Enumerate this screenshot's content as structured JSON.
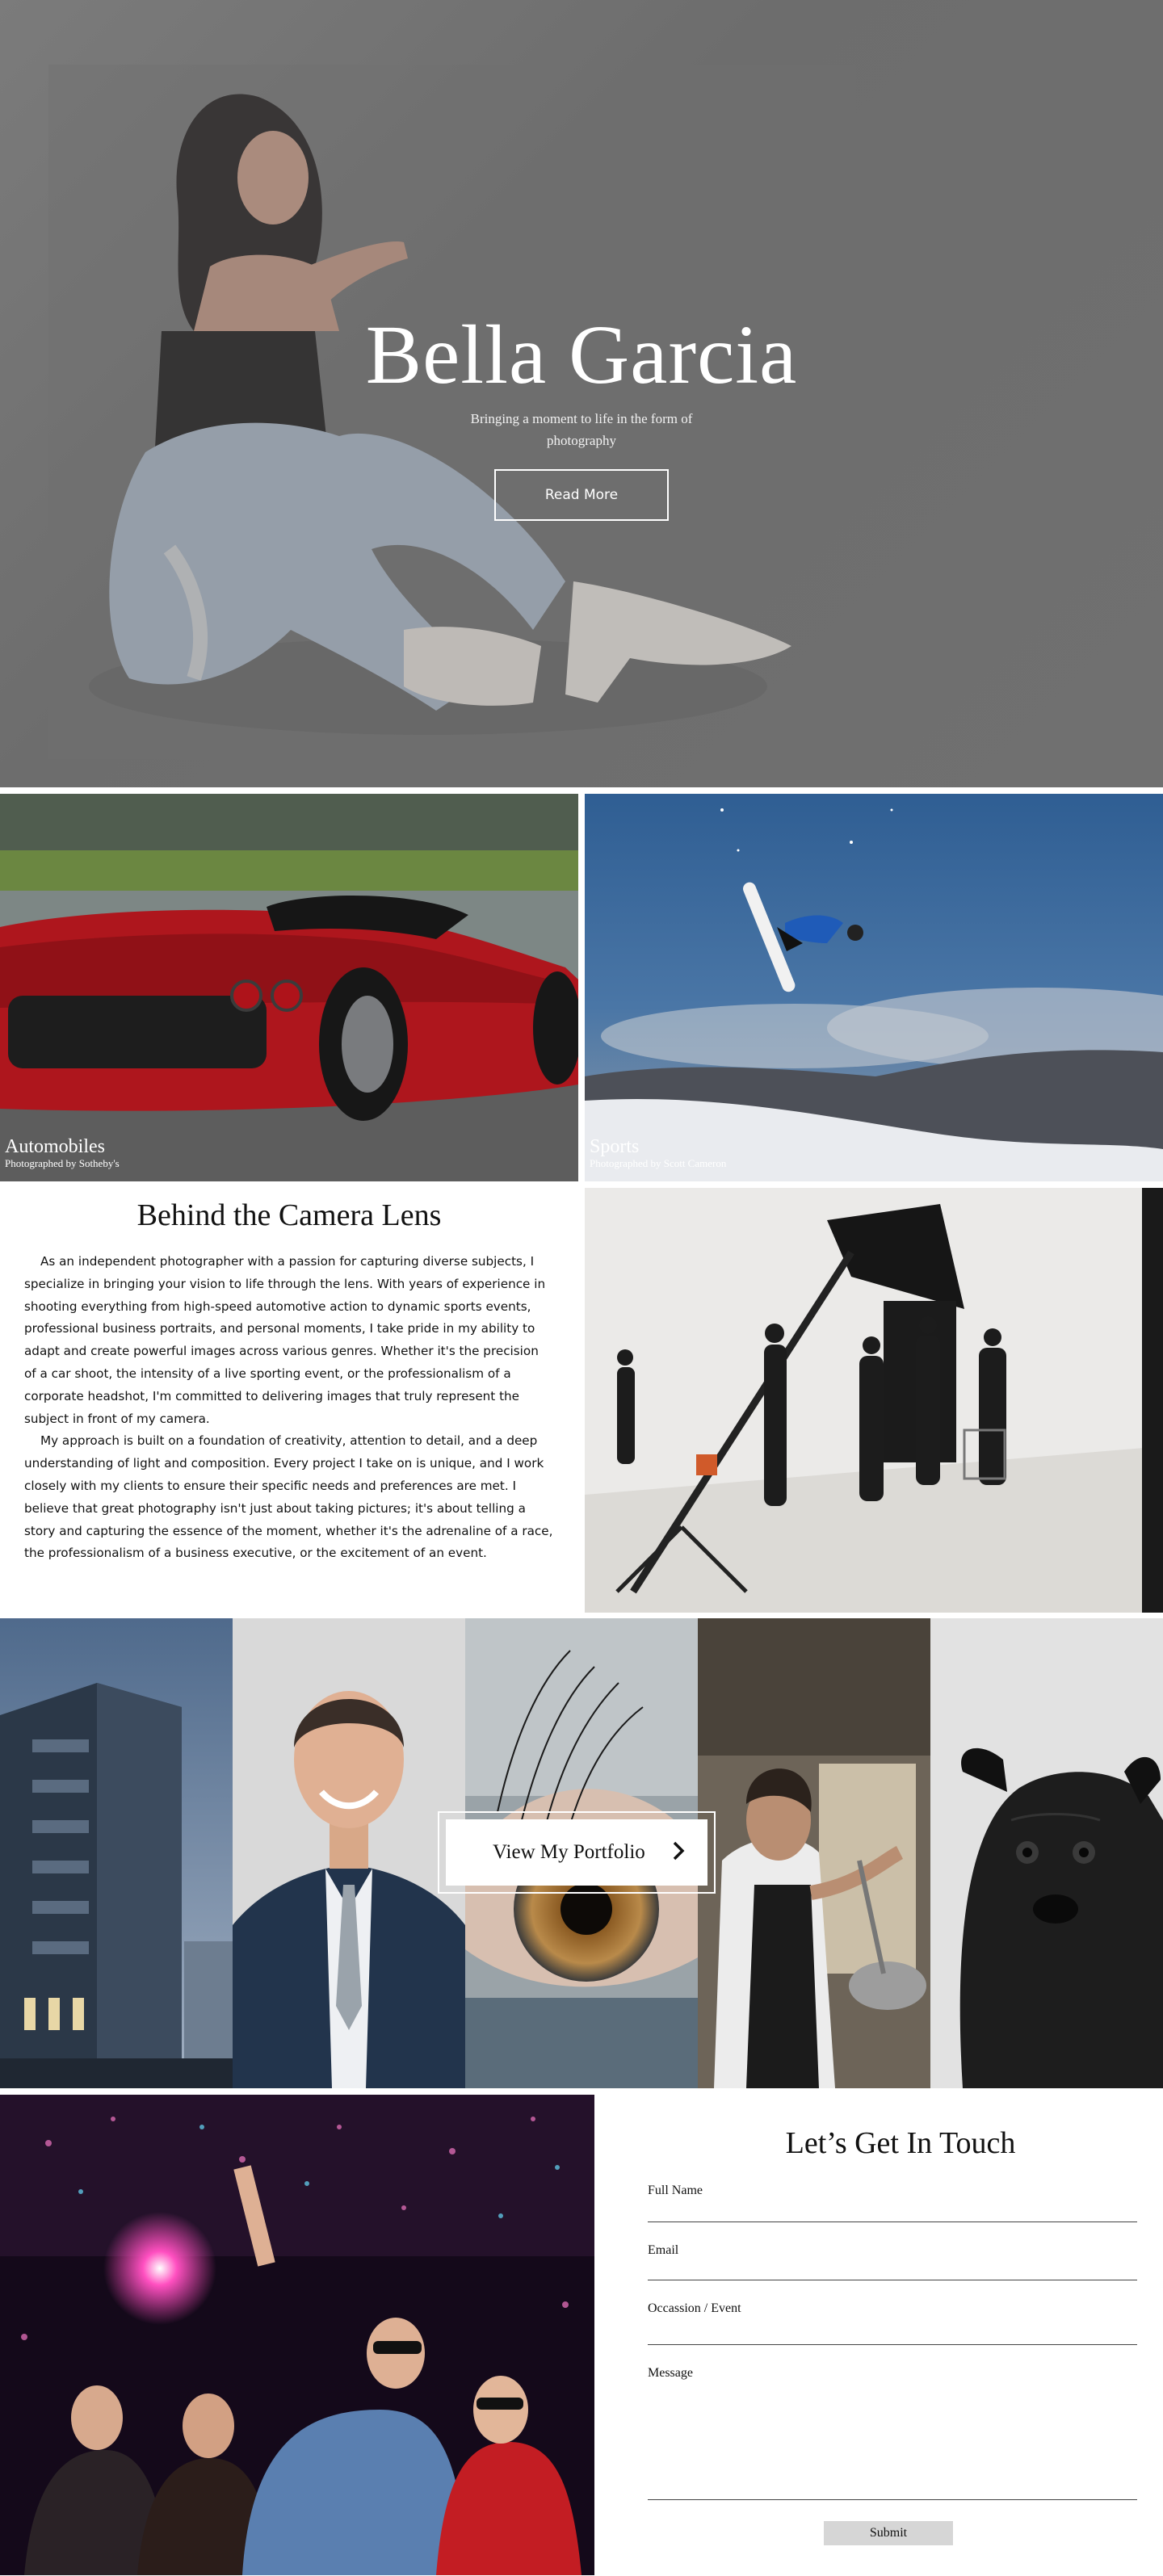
{
  "hero": {
    "title": "Bella Garcia",
    "subtitle": "Bringing a moment to life in the form of photography",
    "button_label": "Read More"
  },
  "tiles": [
    {
      "title": "Automobiles",
      "credit": "Photographed by Sotheby's"
    },
    {
      "title": "Sports",
      "credit": "Photographed by Scott Cameron"
    }
  ],
  "about": {
    "title": "Behind the Camera Lens",
    "paragraphs": [
      "As an independent photographer with a passion for capturing diverse subjects, I specialize in bringing your vision to life through the lens. With years of experience in shooting everything from high-speed automotive action to dynamic sports events, professional business portraits, and personal moments, I take pride in my ability to adapt and create powerful images across various genres. Whether it's the precision of a car shoot, the intensity of a live sporting event, or the professionalism of a corporate headshot, I'm committed to delivering images that truly represent the subject in front of my camera.",
      "My approach is built on a foundation of creativity, attention to detail, and a deep understanding of light and composition. Every project I take on is unique, and I work closely with my clients to ensure their specific needs and preferences are met. I believe that great photography isn't just about taking pictures; it's about telling a story and capturing the essence of the moment, whether it's the adrenaline of a race, the professionalism of a business executive, or the excitement of an event."
    ]
  },
  "portfolio": {
    "button_label": "View My Portfolio"
  },
  "contact": {
    "title": "Let’s Get In Touch",
    "fields": {
      "full_name": "Full Name",
      "email": "Email",
      "occasion": "Occassion / Event",
      "message": "Message"
    },
    "submit_label": "Submit"
  },
  "colors": {
    "hero_overlay": "#6f6f6f",
    "text": "#111111",
    "submit_bg": "#d6d6d6",
    "white": "#ffffff"
  },
  "icons": [
    "chevron-right-icon"
  ]
}
